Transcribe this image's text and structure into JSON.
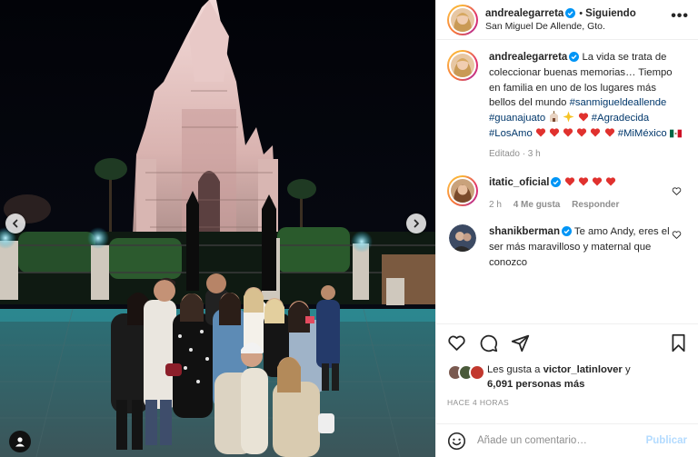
{
  "post": {
    "username": "andrealegarreta",
    "follow_label": "Siguiendo",
    "location": "San Miguel De Allende, Gto.",
    "more_label": "•••"
  },
  "caption": {
    "username": "andrealegarreta",
    "text_1": "La vida se trata de coleccionar buenas memorias… Tiempo en familia en uno de los lugares más bellos del mundo",
    "hashtag_1": "#sanmigueldeallende",
    "hashtag_2": "#guanajuato",
    "hashtag_3": "#Agradecida",
    "hashtag_4": "#LosAmo",
    "hashtag_5": "#MiMéxico",
    "edited": "Editado · 3 h"
  },
  "comments": [
    {
      "username": "itatic_oficial",
      "text": "",
      "time": "2 h",
      "likes": "4 Me gusta",
      "reply": "Responder"
    },
    {
      "username": "shanikberman",
      "text": "Te amo Andy, eres el ser más maravilloso y maternal que conozco"
    }
  ],
  "likes": {
    "prefix": "Les gusta a",
    "user": "victor_latinlover",
    "connector": "y",
    "others": "6,091 personas más"
  },
  "time_ago": "HACE 4 HORAS",
  "add_comment": {
    "placeholder": "Añade un comentario…",
    "publish": "Publicar"
  },
  "colors": {
    "link": "#00376b",
    "verified": "#0095f6",
    "heart": "#ed4956",
    "secondary_text": "#8e8e8e",
    "publish_disabled": "#b3dbff"
  },
  "icons": {
    "photo_prev": "chevron-left-icon",
    "photo_next": "chevron-right-icon",
    "user_tag": "user-icon",
    "like": "heart-icon",
    "comment": "comment-icon",
    "share": "paper-plane-icon",
    "save": "bookmark-icon",
    "emoji": "smiley-icon"
  }
}
